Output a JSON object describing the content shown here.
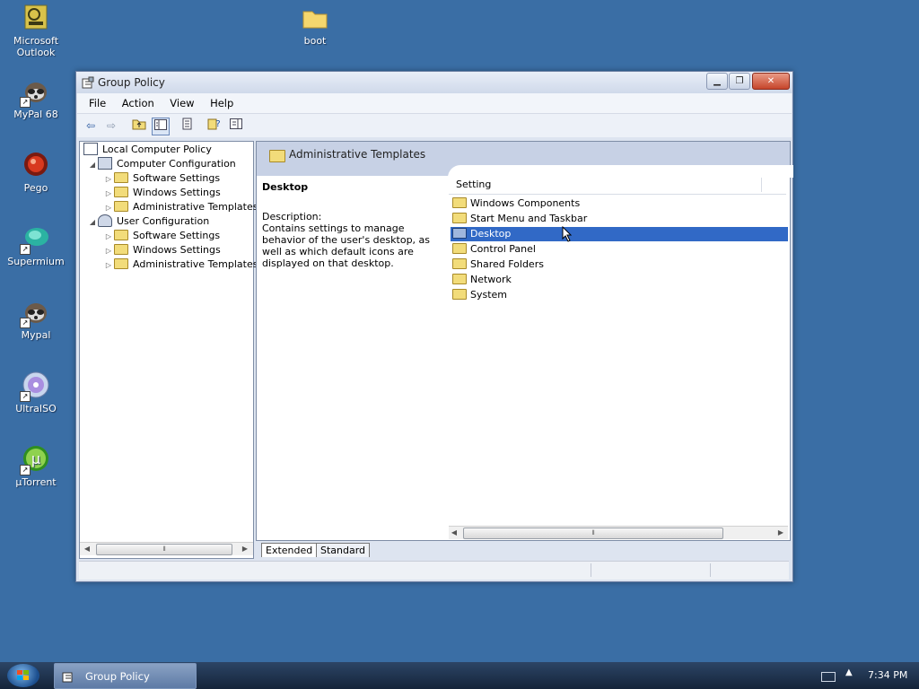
{
  "desktop": {
    "icons": [
      {
        "label": "Microsoft Outlook"
      },
      {
        "label": "boot"
      },
      {
        "label": "MyPal 68"
      },
      {
        "label": "Pego"
      },
      {
        "label": "Supermium"
      },
      {
        "label": "Mypal"
      },
      {
        "label": "UltraISO"
      },
      {
        "label": "µTorrent"
      }
    ]
  },
  "window": {
    "title": "Group Policy",
    "menu": [
      "File",
      "Action",
      "View",
      "Help"
    ],
    "tree": {
      "root": "Local Computer Policy",
      "computer": "Computer Configuration",
      "computer_children": [
        "Software Settings",
        "Windows Settings",
        "Administrative Templates"
      ],
      "user": "User Configuration",
      "user_children": [
        "Software Settings",
        "Windows Settings",
        "Administrative Templates"
      ]
    },
    "right": {
      "header": "Administrative Templates",
      "desc_title": "Desktop",
      "desc_label": "Description:",
      "desc_text": "Contains settings to manage behavior of the user's desktop, as well as which default icons are displayed on that desktop.",
      "column": "Setting",
      "items": [
        "Windows Components",
        "Start Menu and Taskbar",
        "Desktop",
        "Control Panel",
        "Shared Folders",
        "Network",
        "System"
      ],
      "selected_index": 2
    },
    "tabs": [
      "Extended",
      "Standard"
    ]
  },
  "taskbar": {
    "button": "Group Policy",
    "clock": "7:34 PM"
  }
}
